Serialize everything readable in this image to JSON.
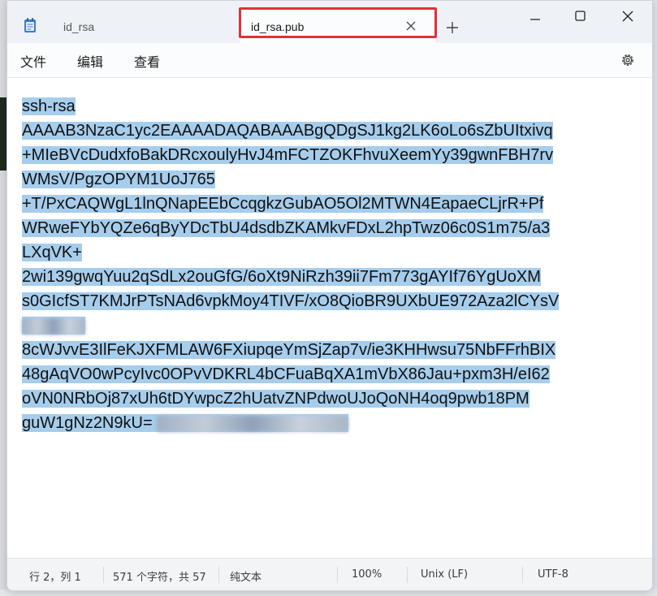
{
  "tabs": [
    {
      "label": "id_rsa",
      "active": false
    },
    {
      "label": "id_rsa.pub",
      "active": true
    }
  ],
  "menu": {
    "file": "文件",
    "edit": "编辑",
    "view": "查看"
  },
  "editor": {
    "lines": [
      "ssh-rsa",
      "AAAAB3NzaC1yc2EAAAADAQABAAABgQDgSJ1kg2LK6oLo6sZbUItxivq",
      "+MIeBVcDudxfoBakDRcxoulyHvJ4mFCTZOKFhvuXeemYy39gwnFBH7rv",
      "WMsV/PgzOPYM1UoJ765",
      "+T/PxCAQWgL1lnQNapEEbCcqgkzGubAO5Ol2MTWN4EapaeCLjrR+Pf",
      "WRweFYbYQZe6qByYDcTbU4dsdbZKAMkvFDxL2hpTwz06c0S1m75/a3",
      "LXqVK+",
      "2wi139gwqYuu2qSdLx2ouGfG/6oXt9NiRzh39ii7Fm773gAYIf76YgUoXM",
      "s0GIcfST7KMJrPTsNAd6vpkMoy4TIVF/xO8QioBR9UXbUE972Aza2lCYsV",
      "",
      "8cWJvvE3IlFeKJXFMLAW6FXiupqeYmSjZap7v/ie3KHHwsu75NbFFrhBIX",
      "48gAqVO0wPcyIvc0OPvVDKRL4bCFuaBqXA1mVbX86Jau+pxm3H/eI62",
      "oVN0NRbOj87xUh6tDYwpcZ2hUatvZNPdwoUJoQoNH4oq9pwb18PM",
      "guW1gNz2N9kU= "
    ]
  },
  "status": {
    "position": "行 2，列 1",
    "chars": "571 个字符，共 57",
    "format": "纯文本",
    "zoom": "100%",
    "line_ending": "Unix (LF)",
    "encoding": "UTF-8"
  },
  "colors": {
    "selection": "#a6cdec",
    "highlight_box": "#e0313a"
  },
  "icons": [
    "notepad-icon",
    "tab-close-icon",
    "plus-icon",
    "minimize-icon",
    "maximize-icon",
    "close-icon",
    "gear-icon"
  ]
}
